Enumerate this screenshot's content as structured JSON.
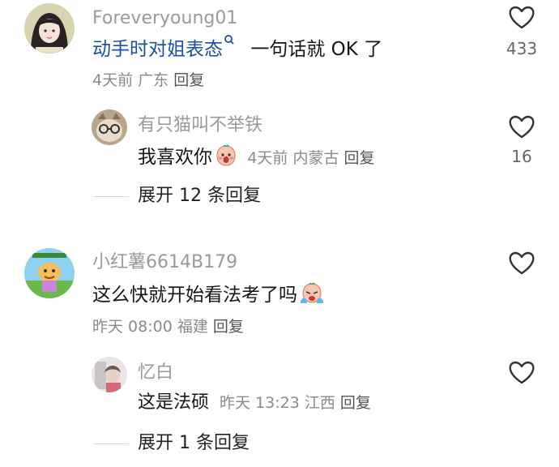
{
  "comments": [
    {
      "username": "Foreveryoung01",
      "link_text": "动手时对姐表态",
      "text_after": "一句话就 OK 了",
      "time": "4天前",
      "region": "广东",
      "reply_label": "回复",
      "likes": "433",
      "reply": {
        "username": "有只猫叫不举铁",
        "text": "我喜欢你",
        "time": "4天前",
        "region": "内蒙古",
        "reply_label": "回复",
        "likes": "16"
      },
      "expand_label": "展开 12 条回复"
    },
    {
      "username": "小红薯6614B179",
      "text": "这么快就开始看法考了吗",
      "time": "昨天 08:00",
      "region": "福建",
      "reply_label": "回复",
      "likes": "",
      "reply": {
        "username": "忆白",
        "text": "这是法硕",
        "time": "昨天 13:23",
        "region": "江西",
        "reply_label": "回复",
        "likes": ""
      },
      "expand_label": "展开 1 条回复"
    }
  ],
  "colors": {
    "link": "#1b4fa8",
    "muted": "#9a9a9a",
    "text": "#161616"
  }
}
